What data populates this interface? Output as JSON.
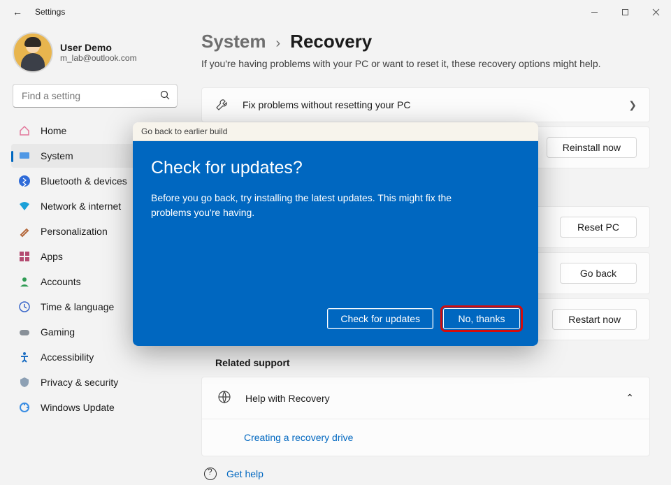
{
  "window": {
    "title": "Settings",
    "minimize_label": "Minimize",
    "maximize_label": "Maximize",
    "close_label": "Close"
  },
  "user": {
    "name": "User Demo",
    "email": "m_lab@outlook.com"
  },
  "search": {
    "placeholder": "Find a setting"
  },
  "nav": {
    "items": [
      {
        "id": "home",
        "label": "Home"
      },
      {
        "id": "system",
        "label": "System"
      },
      {
        "id": "bluetooth",
        "label": "Bluetooth & devices"
      },
      {
        "id": "network",
        "label": "Network & internet"
      },
      {
        "id": "personalization",
        "label": "Personalization"
      },
      {
        "id": "apps",
        "label": "Apps"
      },
      {
        "id": "accounts",
        "label": "Accounts"
      },
      {
        "id": "time",
        "label": "Time & language"
      },
      {
        "id": "gaming",
        "label": "Gaming"
      },
      {
        "id": "accessibility",
        "label": "Accessibility"
      },
      {
        "id": "privacy",
        "label": "Privacy & security"
      },
      {
        "id": "update",
        "label": "Windows Update"
      }
    ],
    "active": "system"
  },
  "breadcrumb": {
    "parent": "System",
    "separator": "›",
    "current": "Recovery"
  },
  "intro": "If you're having problems with your PC or want to reset it, these recovery options might help.",
  "cards": {
    "fix": {
      "title": "Fix problems without resetting your PC"
    },
    "reinstall": {
      "button": "Reinstall now"
    },
    "reset": {
      "button": "Reset PC"
    },
    "goback": {
      "button": "Go back"
    },
    "restart": {
      "button": "Restart now"
    }
  },
  "related": {
    "heading": "Related support",
    "help_with_recovery": "Help with Recovery",
    "recovery_drive": "Creating a recovery drive"
  },
  "get_help": "Get help",
  "modal": {
    "titlebar": "Go back to earlier build",
    "heading": "Check for updates?",
    "body": "Before you go back, try installing the latest updates. This might fix the problems you're having.",
    "primary_btn": "Check for updates",
    "secondary_btn": "No, thanks"
  }
}
